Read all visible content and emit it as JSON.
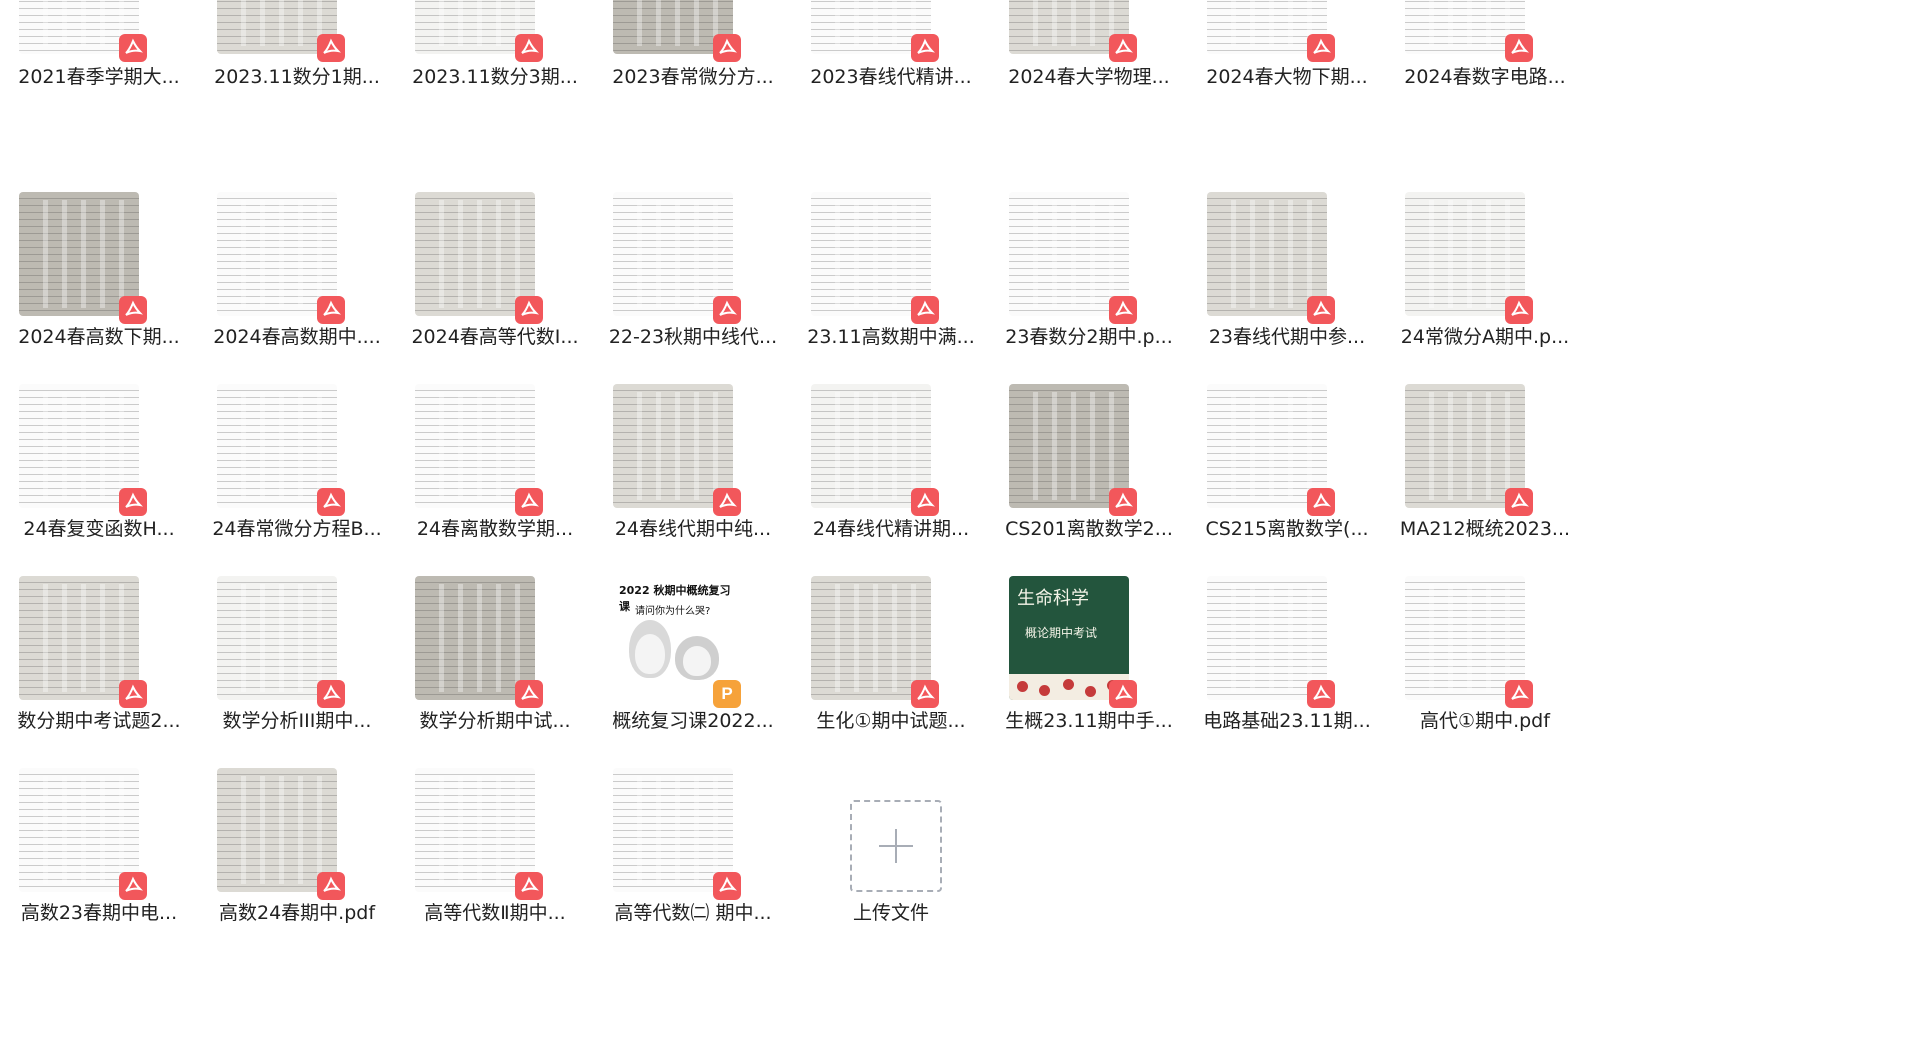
{
  "colors": {
    "pdf_badge": "#f2575b",
    "ppt_badge": "#f6a23a",
    "upload_border": "#a8adb6"
  },
  "rows": [
    [
      {
        "name": "2021春季学期大...",
        "kind": "pdf",
        "icon": "pdf-icon"
      },
      {
        "name": "2023.11数分1期...",
        "kind": "pdf",
        "icon": "pdf-icon"
      },
      {
        "name": "2023.11数分3期...",
        "kind": "pdf",
        "icon": "pdf-icon"
      },
      {
        "name": "2023春常微分方...",
        "kind": "pdf",
        "icon": "pdf-icon"
      },
      {
        "name": "2023春线代精讲...",
        "kind": "pdf",
        "icon": "pdf-icon"
      },
      {
        "name": "2024春大学物理...",
        "kind": "pdf",
        "icon": "pdf-icon"
      },
      {
        "name": "2024春大物下期...",
        "kind": "pdf",
        "icon": "pdf-icon"
      },
      {
        "name": "2024春数字电路...",
        "kind": "pdf",
        "icon": "pdf-icon"
      }
    ],
    [
      {
        "name": "2024春高数下期...",
        "kind": "pdf",
        "icon": "pdf-icon"
      },
      {
        "name": "2024春高数期中....",
        "kind": "pdf",
        "icon": "pdf-icon"
      },
      {
        "name": "2024春高等代数I...",
        "kind": "pdf",
        "icon": "pdf-icon"
      },
      {
        "name": "22-23秋期中线代...",
        "kind": "pdf",
        "icon": "pdf-icon"
      },
      {
        "name": "23.11高数期中满...",
        "kind": "pdf",
        "icon": "pdf-icon"
      },
      {
        "name": "23春数分2期中.p...",
        "kind": "pdf",
        "icon": "pdf-icon"
      },
      {
        "name": "23春线代期中参...",
        "kind": "pdf",
        "icon": "pdf-icon"
      },
      {
        "name": "24常微分A期中.p...",
        "kind": "pdf",
        "icon": "pdf-icon"
      }
    ],
    [
      {
        "name": "24春复变函数H...",
        "kind": "pdf",
        "icon": "pdf-icon"
      },
      {
        "name": "24春常微分方程B...",
        "kind": "pdf",
        "icon": "pdf-icon"
      },
      {
        "name": "24春离散数学期...",
        "kind": "pdf",
        "icon": "pdf-icon"
      },
      {
        "name": "24春线代期中纯...",
        "kind": "pdf",
        "icon": "pdf-icon"
      },
      {
        "name": "24春线代精讲期...",
        "kind": "pdf",
        "icon": "pdf-icon"
      },
      {
        "name": "CS201离散数学2...",
        "kind": "pdf",
        "icon": "pdf-icon"
      },
      {
        "name": "CS215离散数学(...",
        "kind": "pdf",
        "icon": "pdf-icon"
      },
      {
        "name": "MA212概统2023...",
        "kind": "pdf",
        "icon": "pdf-icon"
      }
    ],
    [
      {
        "name": "数分期中考试题2...",
        "kind": "pdf",
        "icon": "pdf-icon"
      },
      {
        "name": "数学分析III期中...",
        "kind": "pdf",
        "icon": "pdf-icon"
      },
      {
        "name": "数学分析期中试...",
        "kind": "pdf",
        "icon": "pdf-icon"
      },
      {
        "name": "概统复习课2022...",
        "kind": "ppt",
        "icon": "ppt-icon",
        "thumb_title": "2022 秋期中概统复习课",
        "thumb_sub": "请问你为什么哭?"
      },
      {
        "name": "生化①期中试题...",
        "kind": "pdf",
        "icon": "pdf-icon"
      },
      {
        "name": "生概23.11期中手...",
        "kind": "pdf",
        "icon": "pdf-icon",
        "thumb_title": "生命科学",
        "thumb_sub": "概论期中考试"
      },
      {
        "name": "电路基础23.11期...",
        "kind": "pdf",
        "icon": "pdf-icon"
      },
      {
        "name": "高代①期中.pdf",
        "kind": "pdf",
        "icon": "pdf-icon"
      }
    ],
    [
      {
        "name": "高数23春期中电...",
        "kind": "pdf",
        "icon": "pdf-icon"
      },
      {
        "name": "高数24春期中.pdf",
        "kind": "pdf",
        "icon": "pdf-icon"
      },
      {
        "name": "高等代数Ⅱ期中...",
        "kind": "pdf",
        "icon": "pdf-icon"
      },
      {
        "name": "高等代数㈡ 期中...",
        "kind": "pdf",
        "icon": "pdf-icon"
      },
      {
        "name": "上传文件",
        "kind": "upload",
        "icon": "plus-icon"
      }
    ]
  ]
}
